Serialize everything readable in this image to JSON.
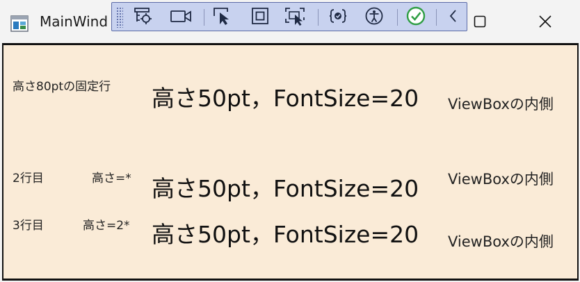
{
  "window": {
    "title": "MainWind",
    "icons": {
      "app": "app-window-icon",
      "restore": "restore-icon",
      "close": "close-icon"
    }
  },
  "devtools": {
    "tools": [
      {
        "name": "live-visual-tree-icon"
      },
      {
        "name": "video-camera-icon"
      },
      {
        "name": "select-element-icon"
      },
      {
        "name": "display-layout-adorners-icon"
      },
      {
        "name": "track-focused-element-icon"
      },
      {
        "name": "binding-failures-icon"
      },
      {
        "name": "accessibility-checker-icon"
      },
      {
        "name": "hot-reload-status-icon"
      },
      {
        "name": "collapse-toolbar-icon"
      }
    ],
    "colors": {
      "bar": "#c8d2ef",
      "border": "#5b6aa6",
      "ok": "#2f9e44"
    }
  },
  "content": {
    "background": "#faebd7",
    "rows": [
      {
        "label_left": "高さ80ptの固定行",
        "label_right": "",
        "main_text": "高さ50pt，FontSize=20",
        "viewbox_text": "ViewBoxの内側"
      },
      {
        "label_left": "2行目",
        "label_right": "高さ=*",
        "main_text": "高さ50pt，FontSize=20",
        "viewbox_text": "ViewBoxの内側"
      },
      {
        "label_left": "3行目",
        "label_right": "高さ=2*",
        "main_text": "高さ50pt，FontSize=20",
        "viewbox_text": "ViewBoxの内側"
      }
    ]
  }
}
